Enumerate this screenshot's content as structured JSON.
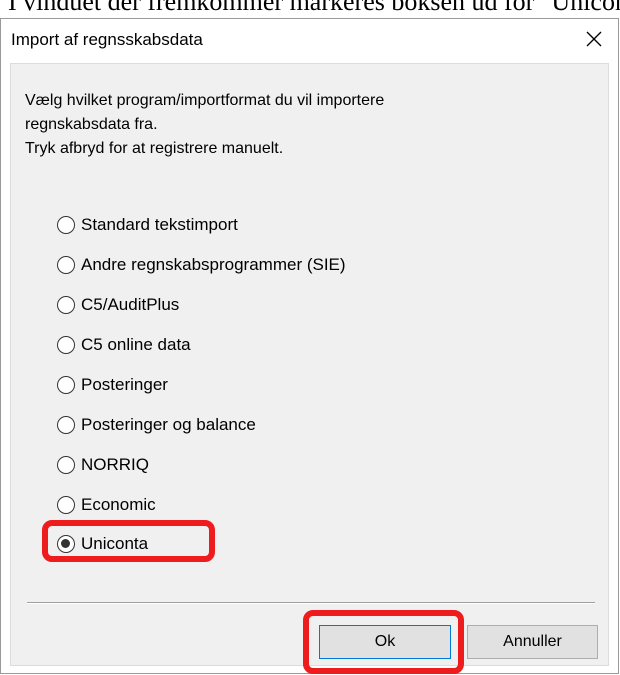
{
  "background_text": "I vinduet der fremkommer markeres boksen ud for \"Uniconta\"",
  "dialog": {
    "title": "Import af regnsskabsdata",
    "close_icon": "close-icon",
    "instructions": [
      "Vælg hvilket program/importformat du vil importere",
      "regnskabsdata fra.",
      "Tryk afbryd for at registrere manuelt."
    ],
    "options": [
      {
        "label": "Standard tekstimport",
        "selected": false
      },
      {
        "label": "Andre regnskabsprogrammer (SIE)",
        "selected": false
      },
      {
        "label": "C5/AuditPlus",
        "selected": false
      },
      {
        "label": "C5 online data",
        "selected": false
      },
      {
        "label": "Posteringer",
        "selected": false
      },
      {
        "label": "Posteringer og balance",
        "selected": false
      },
      {
        "label": "NORRIQ",
        "selected": false
      },
      {
        "label": "Economic",
        "selected": false
      },
      {
        "label": "Uniconta",
        "selected": true
      }
    ],
    "ok_label": "Ok",
    "cancel_label": "Annuller"
  },
  "colors": {
    "highlight": "#ee1c1c",
    "dialog_body": "#f0f0f0",
    "focus_border": "#0078d7"
  }
}
